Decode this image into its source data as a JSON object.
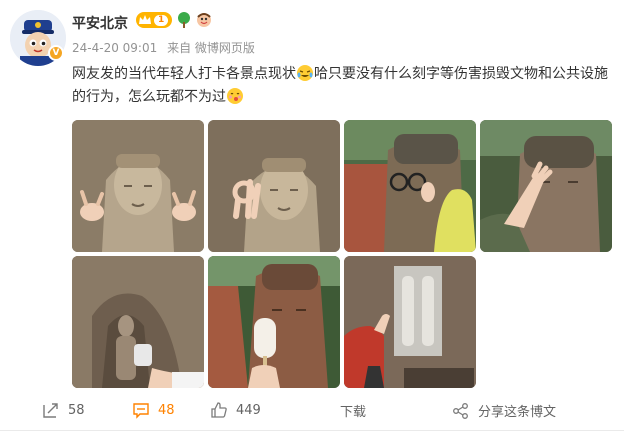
{
  "post": {
    "author": "平安北京",
    "level": "1",
    "timestamp": "24-4-20 09:01",
    "source": "来自 微博网页版",
    "text_part1": "网友发的当代年轻人打卡各景点现状",
    "text_part2": "哈只要没有什么刻字等伤害损毁文物和公共设施的行为，怎么玩都不为过"
  },
  "actions": {
    "repost_count": "58",
    "comment_count": "48",
    "like_count": "449",
    "download_label": "下载",
    "share_label": "分享这条博文"
  },
  "colors": {
    "accent": "#ff8200",
    "level_badge": "#ffb400",
    "verified": "#f5a623"
  },
  "images": [
    {
      "name": "buddha-ok-hands-1"
    },
    {
      "name": "buddha-ok-hand-2"
    },
    {
      "name": "buddha-glasses-3"
    },
    {
      "name": "buddha-salute-4"
    },
    {
      "name": "cave-buddha-cup-5"
    },
    {
      "name": "leshan-popsicle-6"
    },
    {
      "name": "cliff-statues-hand-7"
    }
  ]
}
